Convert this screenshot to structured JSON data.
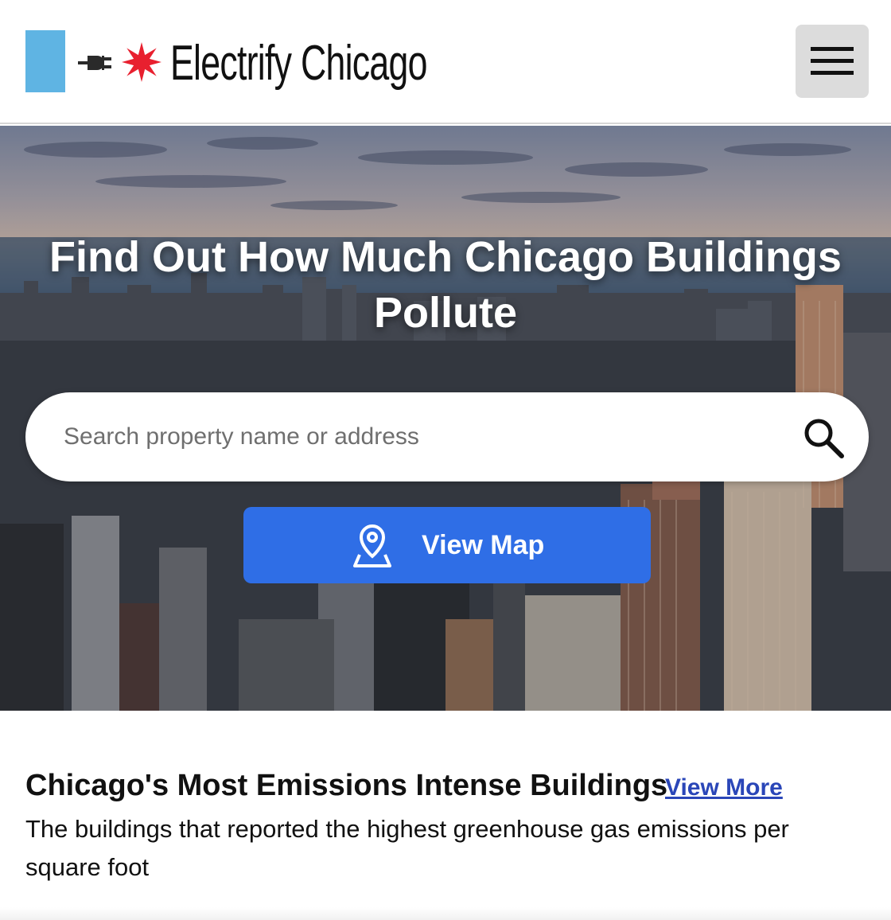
{
  "header": {
    "brand": "Electrify Chicago",
    "logo_icons": [
      "plug-icon",
      "star-icon"
    ],
    "menu_icon": "hamburger-menu-icon",
    "colors": {
      "blue_bar": "#5fb4e3",
      "star": "#e8202f",
      "menu_bg": "#dcdcdc"
    }
  },
  "hero": {
    "title": "Find Out How Much Chicago Buildings Pollute",
    "search": {
      "placeholder": "Search property name or address",
      "value": "",
      "icon": "search-icon"
    },
    "map_button": {
      "label": "View Map",
      "icon": "map-pin-icon",
      "color": "#2f6ee6"
    }
  },
  "section": {
    "title": "Chicago's Most Emissions Intense Buildings",
    "view_more": "View More",
    "description": "The buildings that reported the highest greenhouse gas emissions per square foot",
    "link_color": "#2a46b8"
  }
}
